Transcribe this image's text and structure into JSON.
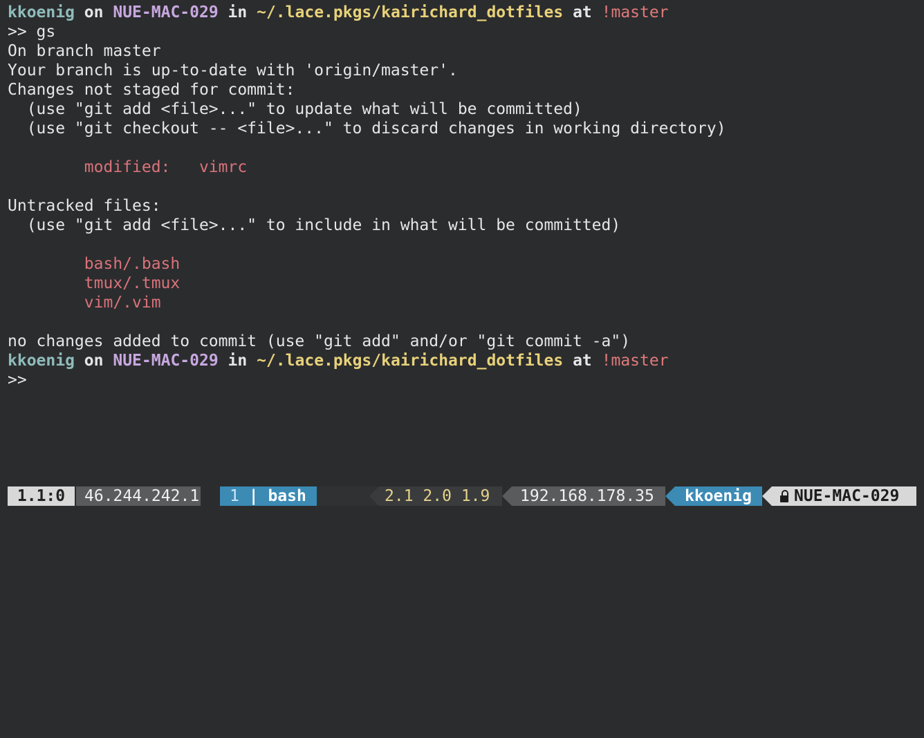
{
  "prompt1": {
    "user": "kkoenig",
    "on": "on",
    "host": "NUE-MAC-029",
    "in": "in",
    "path": "~/.lace.pkgs/kairichard_dotfiles",
    "at": "at",
    "branch": "!master"
  },
  "command": ">> gs",
  "output": {
    "l1": "On branch master",
    "l2": "Your branch is up-to-date with 'origin/master'.",
    "l3": "Changes not staged for commit:",
    "l4": "  (use \"git add <file>...\" to update what will be committed)",
    "l5": "  (use \"git checkout -- <file>...\" to discard changes in working directory)",
    "modified_indent": "        ",
    "modified_label": "modified:   vimrc",
    "l7": "Untracked files:",
    "l8": "  (use \"git add <file>...\" to include in what will be committed)",
    "untracked": [
      "bash/.bash",
      "tmux/.tmux",
      "vim/.vim"
    ],
    "l10": "no changes added to commit (use \"git add\" and/or \"git commit -a\")"
  },
  "prompt2": {
    "user": "kkoenig",
    "on": "on",
    "host": "NUE-MAC-029",
    "in": "in",
    "path": "~/.lace.pkgs/kairichard_dotfiles",
    "at": "at",
    "branch": "!master"
  },
  "prompt_marker": ">>",
  "statusbar": {
    "session": "1.1:0",
    "public_ip": "46.244.242.1",
    "window_index": "1",
    "window_sep": "|",
    "window_name": "bash",
    "load1": "2.1",
    "load2": "2.0",
    "load3": "1.9",
    "local_ip": "192.168.178.35",
    "user": "kkoenig",
    "lock_icon": "lock-icon",
    "host": "NUE-MAC-029"
  },
  "colors": {
    "background": "#2b2c2e",
    "user": "#8fbcbb",
    "host": "#c8a8e0",
    "path": "#e8d27a",
    "branch": "#e07a7a",
    "status_blue": "#3b8bb5",
    "status_grey": "#5a5b5d"
  }
}
